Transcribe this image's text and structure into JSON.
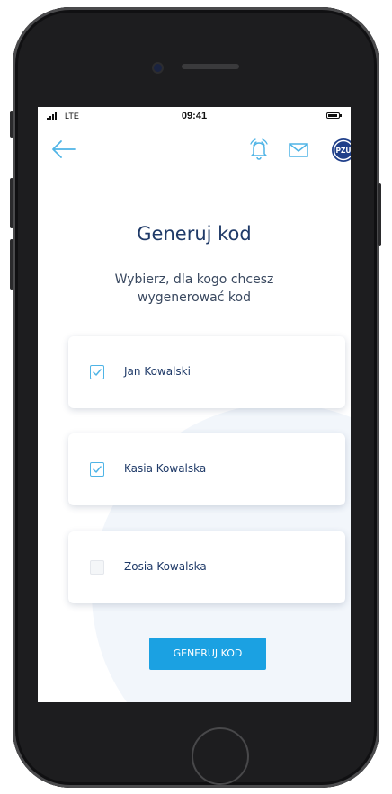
{
  "status_bar": {
    "carrier": "LTE",
    "time": "09:41"
  },
  "header": {
    "back_icon": "arrow-left-icon",
    "bell_icon": "bell-ringing-icon",
    "mail_icon": "mail-icon",
    "logo_text": "PZU"
  },
  "main": {
    "title": "Generuj kod",
    "subtitle": "Wybierz, dla kogo chcesz wygenerować kod",
    "people": [
      {
        "name": "Jan Kowalski",
        "checked": true
      },
      {
        "name": "Kasia Kowalska",
        "checked": true
      },
      {
        "name": "Zosia Kowalska",
        "checked": false
      }
    ],
    "generate_label": "GENERUJ KOD"
  },
  "colors": {
    "accent": "#1ba1e2",
    "title": "#1f3a68",
    "check": "#4fb4e6",
    "logo": "#1f3f8a"
  }
}
